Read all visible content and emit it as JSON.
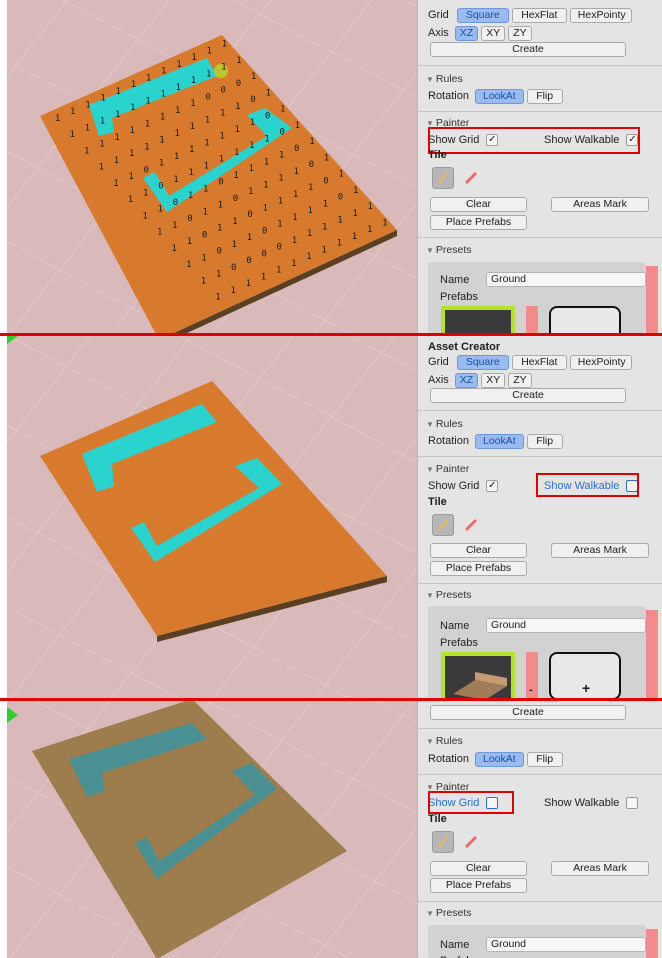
{
  "inspector": {
    "title": "Asset Creator",
    "grid_label": "Grid",
    "grid_options": [
      "Square",
      "HexFlat",
      "HexPointy"
    ],
    "axis_label": "Axis",
    "axis_options": [
      "XZ",
      "XY",
      "ZY"
    ],
    "create_label": "Create",
    "rules_header": "Rules",
    "rotation_label": "Rotation",
    "rotation_options": [
      "LookAt",
      "Flip"
    ],
    "painter_header": "Painter",
    "show_grid_label": "Show Grid",
    "show_walkable_label": "Show Walkable",
    "tile_label": "Tile",
    "clear_label": "Clear",
    "areas_mark_label": "Areas Mark",
    "place_prefabs_label": "Place Prefabs",
    "presets_header": "Presets",
    "name_label": "Name",
    "name_value": "Ground",
    "prefabs_label": "Prefabs",
    "remove_symbol": "-",
    "add_symbol": "+"
  },
  "states": [
    {
      "show_grid": true,
      "show_walkable": true
    },
    {
      "show_grid": true,
      "show_walkable": false
    },
    {
      "show_grid": false,
      "show_walkable": false
    }
  ],
  "walkable_digit": "0",
  "blocked_digit": "1",
  "colors": {
    "ground": "#d77a2e",
    "ground_dim": "#9d7c4e",
    "walkable": "#2bd3cf",
    "walkable_dim": "#4a8f92",
    "highlight": "#e00000",
    "selected": "#99bbf0"
  }
}
